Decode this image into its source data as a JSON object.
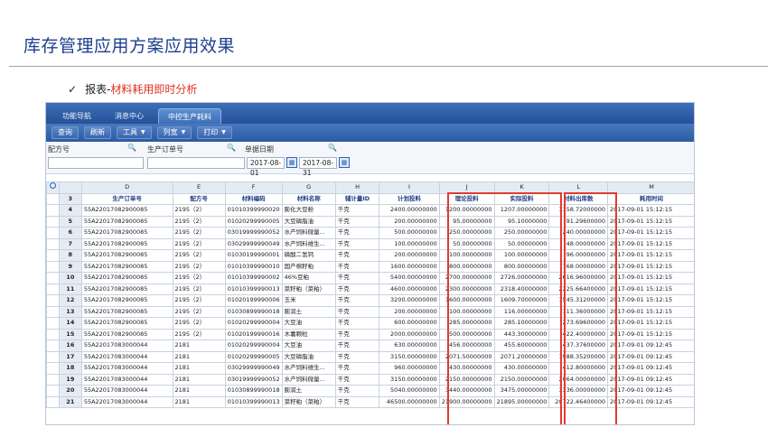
{
  "slide": {
    "title": "库存管理应用方案应用效果",
    "bullet_check": "✓",
    "bullet_prefix": "报表-",
    "bullet_highlight": "材料耗用即时分析"
  },
  "app": {
    "tabs": [
      "功能导航",
      "消息中心",
      "中控生产耗料"
    ],
    "active_tab": 2,
    "toolbar": {
      "query": "查询",
      "refresh": "刷新",
      "tools": "工具",
      "columns": "列宽",
      "print": "打印",
      "caret": "▼"
    },
    "filters": {
      "formula_label": "配方号",
      "order_label": "生产订单号",
      "date_label": "单据日期",
      "date_from": "2017-08-01",
      "date_to": "2017-08-31",
      "search_icon": "🔍",
      "calendar_icon": "📅"
    },
    "grid": {
      "column_letters": [
        "D",
        "E",
        "F",
        "G",
        "H",
        "I",
        "J",
        "K",
        "L",
        "M"
      ],
      "header_row_num": "3",
      "headers": [
        "生产订单号",
        "配方号",
        "材料编码",
        "材料名称",
        "辅计量ID",
        "计划投料",
        "理论投料",
        "实际投料",
        "材料出库数",
        "耗用时间"
      ],
      "rows": [
        {
          "n": "4",
          "c": [
            "55A22017082900085",
            "2195（2）",
            "01010399990020",
            "膨化大豆粉",
            "千克",
            "2400.00000000",
            "1200.00000000",
            "1207.00000000",
            "1158.72000000",
            "2017-09-01 15:12:15"
          ]
        },
        {
          "n": "5",
          "c": [
            "55A22017082900085",
            "2195（2）",
            "01020299990005",
            "大豆磷脂油",
            "千克",
            "200.00000000",
            "95.00000000",
            "95.10000000",
            "91.29600000",
            "2017-09-01 15:12:15"
          ]
        },
        {
          "n": "6",
          "c": [
            "55A22017082900085",
            "2195（2）",
            "03019999990052",
            "水产饲料微量...",
            "千克",
            "500.00000000",
            "250.00000000",
            "250.00000000",
            "240.00000000",
            "2017-09-01 15:12:15"
          ]
        },
        {
          "n": "7",
          "c": [
            "55A22017082900085",
            "2195（2）",
            "03029999990049",
            "水产饲料维生...",
            "千克",
            "100.00000000",
            "50.00000000",
            "50.00000000",
            "48.00000000",
            "2017-09-01 15:12:15"
          ]
        },
        {
          "n": "8",
          "c": [
            "55A22017082900085",
            "2195（2）",
            "01030199990001",
            "磷酸二氢钙",
            "千克",
            "200.00000000",
            "100.00000000",
            "100.00000000",
            "96.00000000",
            "2017-09-01 15:12:15"
          ]
        },
        {
          "n": "9",
          "c": [
            "55A22017082900085",
            "2195（2）",
            "01010399990010",
            "国产棉籽粕",
            "千克",
            "1600.00000000",
            "800.00000000",
            "800.00000000",
            "768.00000000",
            "2017-09-01 15:12:15"
          ]
        },
        {
          "n": "10",
          "c": [
            "55A22017082900085",
            "2195（2）",
            "01010399990002",
            "46%豆粕",
            "千克",
            "5400.00000000",
            "2700.00000000",
            "2726.00000000",
            "2616.96000000",
            "2017-09-01 15:12:15"
          ]
        },
        {
          "n": "11",
          "c": [
            "55A22017082900085",
            "2195（2）",
            "01010399990013",
            "菜籽粕（菜粕）",
            "千克",
            "4600.00000000",
            "2300.00000000",
            "2318.40000000",
            "2225.66400000",
            "2017-09-01 15:12:15"
          ]
        },
        {
          "n": "12",
          "c": [
            "55A22017082900085",
            "2195（2）",
            "01020199990006",
            "玉米",
            "千克",
            "3200.00000000",
            "1600.00000000",
            "1609.70000000",
            "1545.31200000",
            "2017-09-01 15:12:15"
          ]
        },
        {
          "n": "13",
          "c": [
            "55A22017082900085",
            "2195（2）",
            "01030899990018",
            "膨润土",
            "千克",
            "200.00000000",
            "100.00000000",
            "116.00000000",
            "111.36000000",
            "2017-09-01 15:12:15"
          ]
        },
        {
          "n": "14",
          "c": [
            "55A22017082900085",
            "2195（2）",
            "01020299990004",
            "大豆油",
            "千克",
            "600.00000000",
            "285.00000000",
            "285.10000000",
            "273.69600000",
            "2017-09-01 15:12:15"
          ]
        },
        {
          "n": "15",
          "c": [
            "55A22017082900085",
            "2195（2）",
            "01020199990016",
            "木薯颗粒",
            "千克",
            "2000.00000000",
            "500.00000000",
            "443.30000000",
            "422.40000000",
            "2017-09-01 15:12:15"
          ]
        },
        {
          "n": "16",
          "c": [
            "55A22017083000044",
            "2181",
            "01020299990004",
            "大豆油",
            "千克",
            "630.00000000",
            "456.00000000",
            "455.60000000",
            "437.37600000",
            "2017-09-01 09:12:45"
          ]
        },
        {
          "n": "17",
          "c": [
            "55A22017083000044",
            "2181",
            "01020299990005",
            "大豆磷脂油",
            "千克",
            "3150.00000000",
            "2071.50000000",
            "2071.20000000",
            "1988.35200000",
            "2017-09-01 09:12:45"
          ]
        },
        {
          "n": "18",
          "c": [
            "55A22017083000044",
            "2181",
            "03029999990049",
            "水产饲料维生...",
            "千克",
            "960.00000000",
            "430.00000000",
            "430.00000000",
            "412.80000000",
            "2017-09-01 09:12:45"
          ]
        },
        {
          "n": "19",
          "c": [
            "55A22017083000044",
            "2181",
            "03019999990052",
            "水产饲料微量...",
            "千克",
            "3150.00000000",
            "2150.00000000",
            "2150.00000000",
            "2064.00000000",
            "2017-09-01 09:12:45"
          ]
        },
        {
          "n": "20",
          "c": [
            "55A22017083000044",
            "2181",
            "01030899990018",
            "膨润土",
            "千克",
            "5040.00000000",
            "3440.00000000",
            "3475.00000000",
            "3336.00000000",
            "2017-09-01 09:12:45"
          ]
        },
        {
          "n": "21",
          "c": [
            "55A22017083000044",
            "2181",
            "01010399990013",
            "菜籽粕（菜粕）",
            "千克",
            "46500.00000000",
            "21900.00000000",
            "21895.00000000",
            "20722.46400000",
            "2017-09-01 09:12:45"
          ]
        }
      ]
    }
  },
  "colors": {
    "title_blue": "#1d3f8f",
    "highlight_red": "#e0301e",
    "app_bar_blue": "#2a5aa3",
    "box_red": "#e23b2e"
  }
}
